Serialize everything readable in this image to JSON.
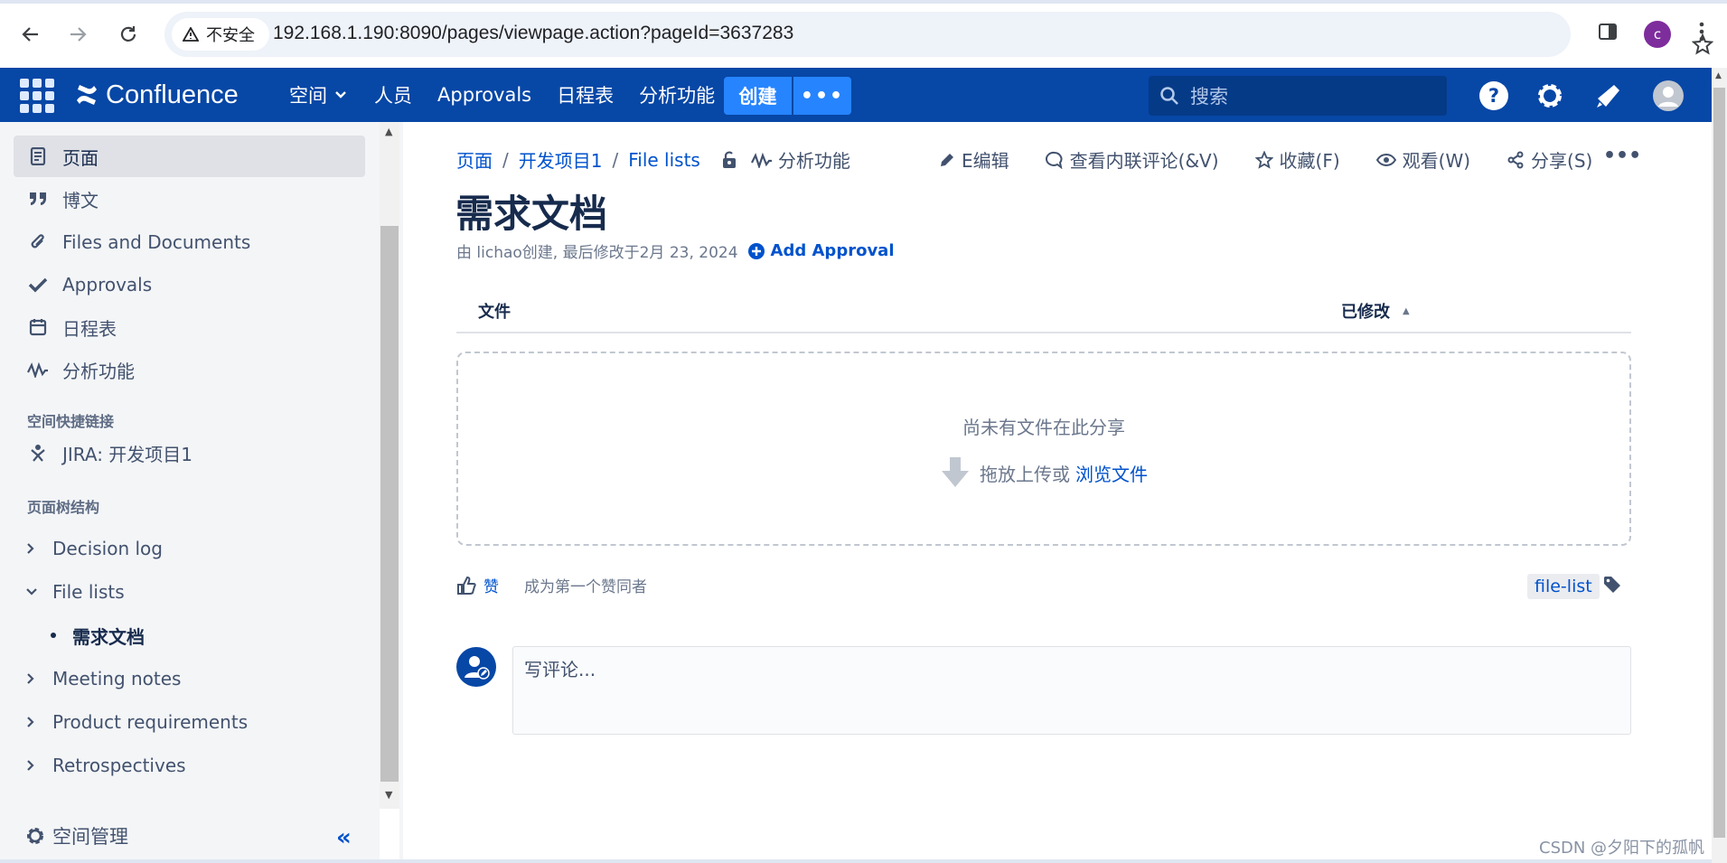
{
  "browser": {
    "insecure_label": "不安全",
    "url": "192.168.1.190:8090/pages/viewpage.action?pageId=3637283",
    "profile_initial": "c"
  },
  "appbar": {
    "logo": "Confluence",
    "nav": [
      "空间",
      "人员",
      "Approvals",
      "日程表",
      "分析功能"
    ],
    "create": "创建",
    "more": "•••",
    "search_placeholder": "搜索"
  },
  "sidebar": {
    "items": [
      {
        "label": "页面",
        "icon": "page-icon"
      },
      {
        "label": "博文",
        "icon": "quote-icon"
      },
      {
        "label": "Files and Documents",
        "icon": "paperclip-icon"
      },
      {
        "label": "Approvals",
        "icon": "check-icon"
      },
      {
        "label": "日程表",
        "icon": "calendar-icon"
      },
      {
        "label": "分析功能",
        "icon": "analytics-icon"
      }
    ],
    "shortcuts_heading": "空间快捷链接",
    "shortcut": "JIRA: 开发项目1",
    "tree_heading": "页面树结构",
    "tree": [
      "Decision log",
      "File lists",
      "Meeting notes",
      "Product requirements",
      "Retrospectives"
    ],
    "tree_child": "需求文档",
    "space_admin": "空间管理"
  },
  "page": {
    "breadcrumb": [
      "页面",
      "开发项目1",
      "File lists"
    ],
    "analytics": "分析功能",
    "actions": [
      "E编辑",
      "查看内联评论(&V)",
      "收藏(F)",
      "观看(W)",
      "分享(S)"
    ],
    "title": "需求文档",
    "byline": "由 lichao创建, 最后修改于2月 23, 2024",
    "add_approval": "Add Approval",
    "file_col": "文件",
    "modified_col": "已修改",
    "empty_msg": "尚未有文件在此分享",
    "upload_hint": "拖放上传或",
    "browse": "浏览文件",
    "like": "赞",
    "first_like": "成为第一个赞同者",
    "label": "file-list",
    "comment_placeholder": "写评论..."
  },
  "watermark": "CSDN @夕阳下的孤帆",
  "colors": {
    "appbar": "#0747a6",
    "create": "#2684ff",
    "link": "#0052cc"
  }
}
